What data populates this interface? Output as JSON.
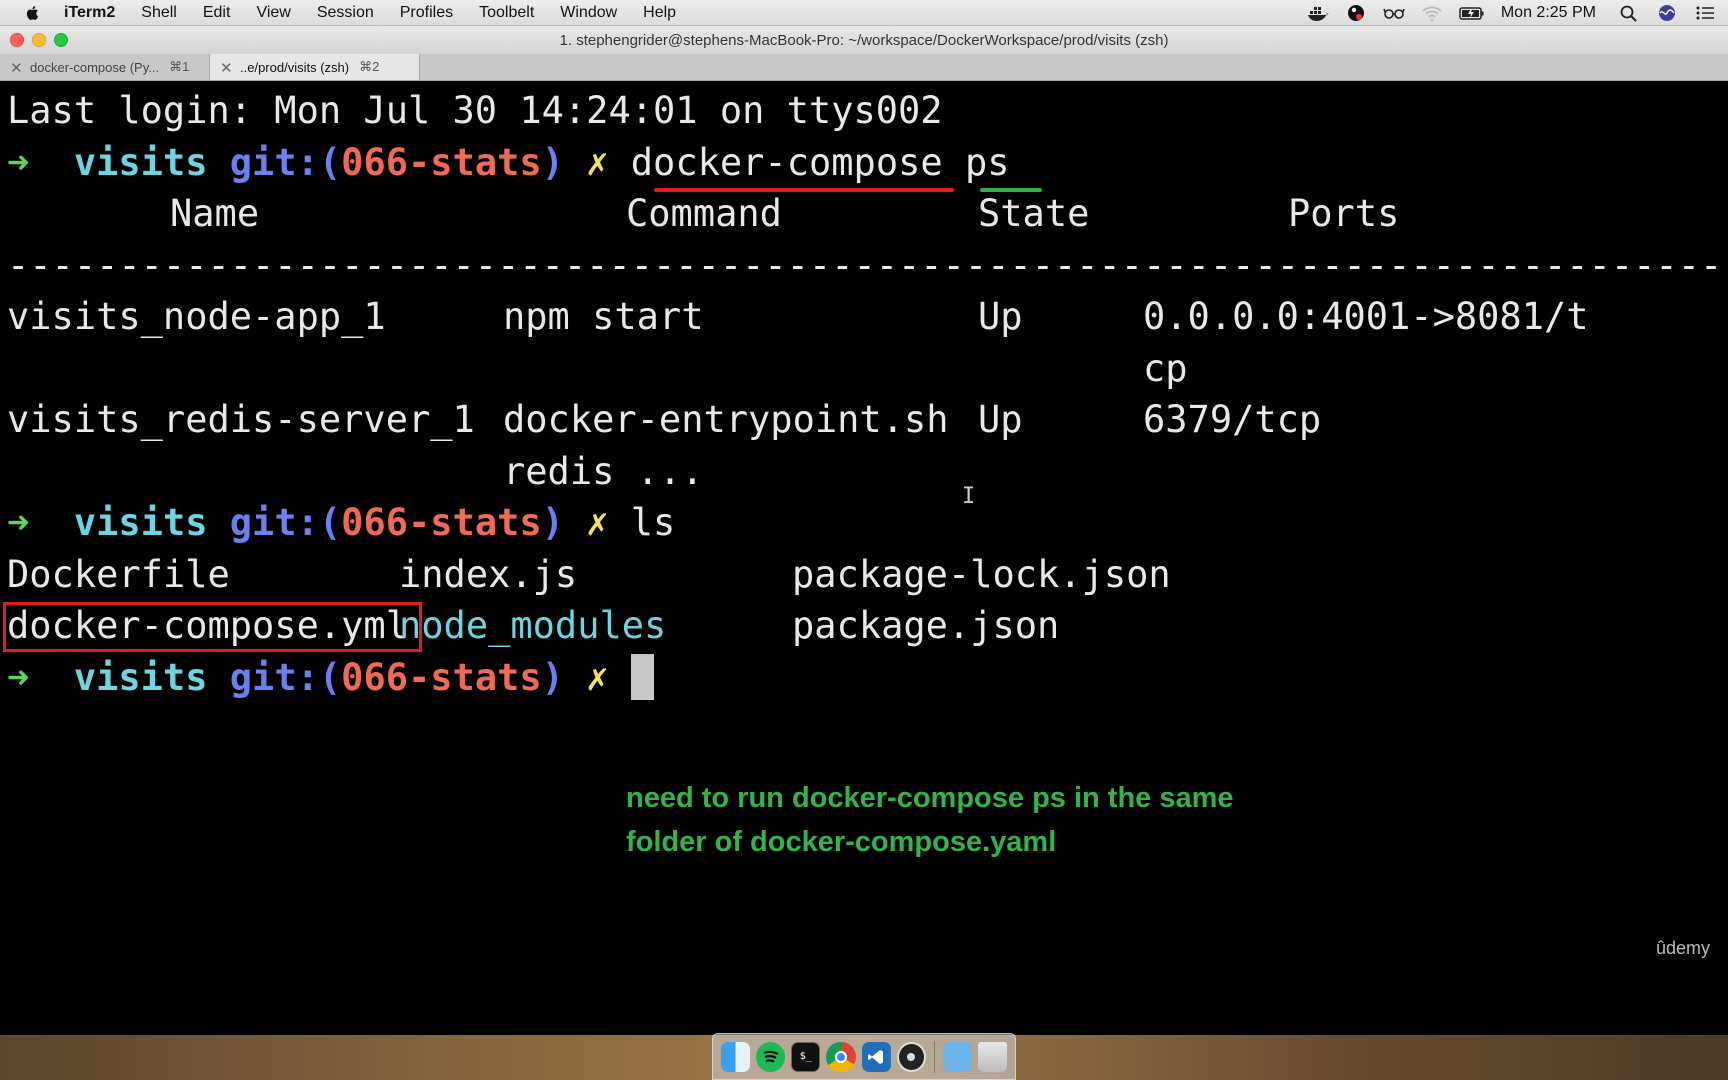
{
  "menubar": {
    "app_name": "iTerm2",
    "menus": [
      "Shell",
      "Edit",
      "View",
      "Session",
      "Profiles",
      "Toolbelt",
      "Window",
      "Help"
    ],
    "clock": "Mon 2:25 PM"
  },
  "window": {
    "title": "1. stephengrider@stephens-MacBook-Pro: ~/workspace/DockerWorkspace/prod/visits (zsh)"
  },
  "tabs": [
    {
      "label": "docker-compose (Py...",
      "shortcut": "⌘1",
      "active": false
    },
    {
      "label": "..e/prod/visits (zsh)",
      "shortcut": "⌘2",
      "active": true
    }
  ],
  "terminal": {
    "last_login": "Last login: Mon Jul 30 14:24:01 on ttys002",
    "prompt": {
      "arrow": "➜",
      "dir": "visits",
      "git": "git:(",
      "branch": "066-stats",
      "git_close": ")",
      "dirty": "✗"
    },
    "cmd1": {
      "main": "docker-compose",
      "arg": "ps"
    },
    "ps_headers": {
      "name": "Name",
      "command": "Command",
      "state": "State",
      "ports": "Ports"
    },
    "separator": "-----------------------------------------------------------------------------------",
    "ps_rows": [
      {
        "name": "visits_node-app_1",
        "command": "npm start",
        "state": "Up",
        "ports": "0.0.0.0:4001->8081/t",
        "ports_wrap": "cp",
        "command_wrap": ""
      },
      {
        "name": "visits_redis-server_1",
        "command": "docker-entrypoint.sh",
        "state": "Up",
        "ports": "6379/tcp",
        "ports_wrap": "",
        "command_wrap": "redis ..."
      }
    ],
    "cmd2": "ls",
    "ls_files": {
      "row1": [
        "Dockerfile",
        "index.js",
        "package-lock.json"
      ],
      "row2": [
        "docker-compose.yml",
        "node_modules",
        "package.json"
      ]
    }
  },
  "annotation": {
    "note_line1": "need to run docker-compose ps in the same",
    "note_line2": "folder of docker-compose.yaml"
  },
  "watermark": "ûdemy",
  "colors": {
    "prompt_arrow": "#5fd35f",
    "dir": "#6fd4e2",
    "git": "#6a7ff0",
    "branch": "#f06a55",
    "dirty_mark": "#f2e35a",
    "annotation_red": "#e8181e",
    "annotation_green": "#34b34a"
  },
  "dock": {
    "apps": [
      "finder-icon",
      "spotify-icon",
      "terminal-icon",
      "chrome-icon",
      "vscode-icon",
      "obs-icon",
      "folder-icon",
      "trash-icon"
    ]
  }
}
